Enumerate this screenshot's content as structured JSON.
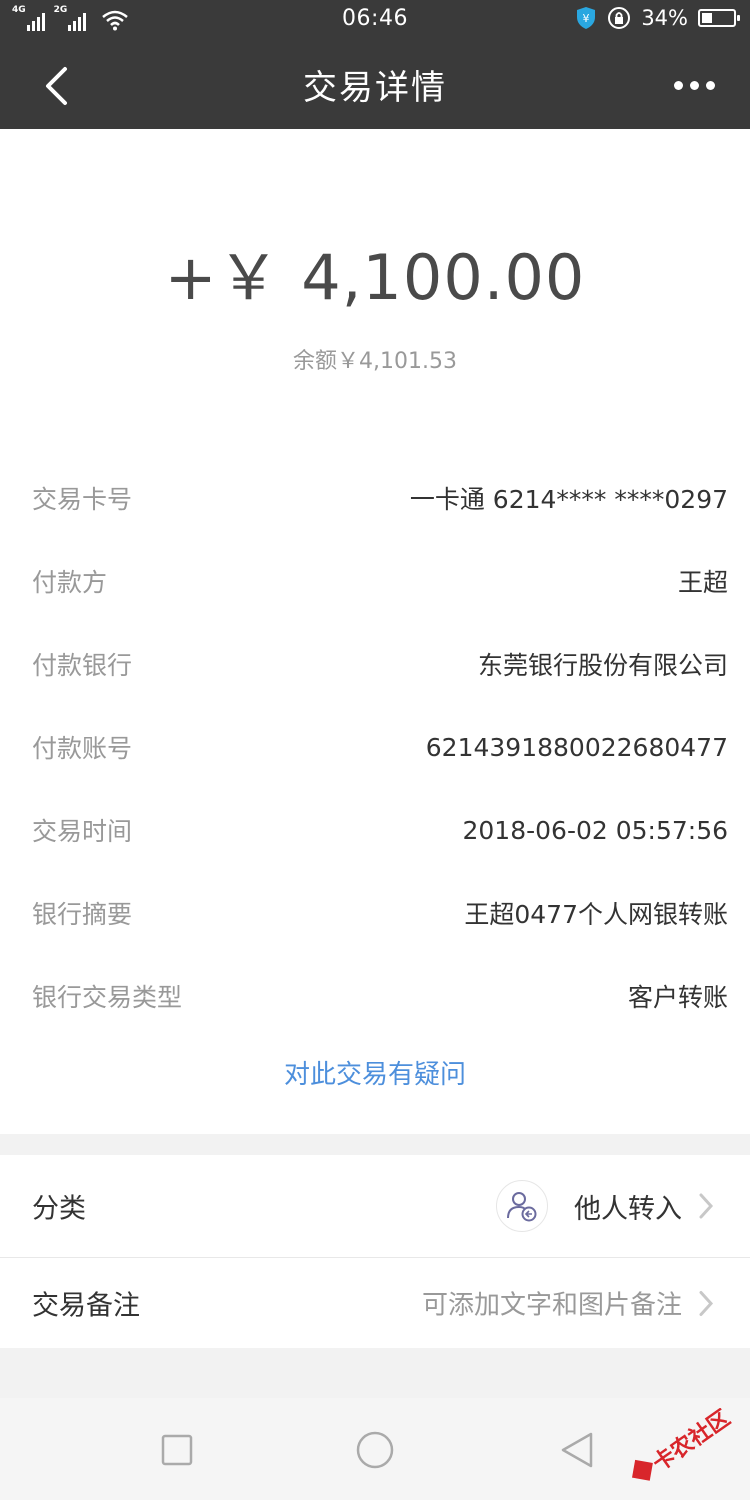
{
  "status_bar": {
    "network_1": "4G",
    "network_2": "2G",
    "time": "06:46",
    "battery_percent": "34%",
    "battery_level": 0.34,
    "icons": [
      "signal-4g-icon",
      "signal-2g-icon",
      "wifi-icon",
      "shield-icon",
      "rotation-lock-icon",
      "battery-icon"
    ]
  },
  "nav": {
    "title": "交易详情",
    "back_icon": "chevron-left-icon",
    "more_icon": "more-dots-icon"
  },
  "summary": {
    "amount": "+￥ 4,100.00",
    "balance": "余额￥4,101.53"
  },
  "details": [
    {
      "label": "交易卡号",
      "value": "一卡通 6214**** ****0297"
    },
    {
      "label": "付款方",
      "value": "王超"
    },
    {
      "label": "付款银行",
      "value": "东莞银行股份有限公司"
    },
    {
      "label": "付款账号",
      "value": "6214391880022680477"
    },
    {
      "label": "交易时间",
      "value": "2018-06-02 05:57:56"
    },
    {
      "label": "银行摘要",
      "value": "王超0477个人网银转账"
    },
    {
      "label": "银行交易类型",
      "value": "客户转账"
    }
  ],
  "query_link": "对此交易有疑问",
  "category": {
    "label": "分类",
    "value": "他人转入",
    "icon": "person-transfer-icon"
  },
  "note": {
    "label": "交易备注",
    "placeholder": "可添加文字和图片备注"
  },
  "nav_keys": [
    "recent-apps-icon",
    "home-icon",
    "back-triangle-icon"
  ],
  "watermark": "卡农社区",
  "colors": {
    "header_bg": "#3a3a3a",
    "link_blue": "#4d8fdc",
    "watermark_red": "#d8262b"
  }
}
